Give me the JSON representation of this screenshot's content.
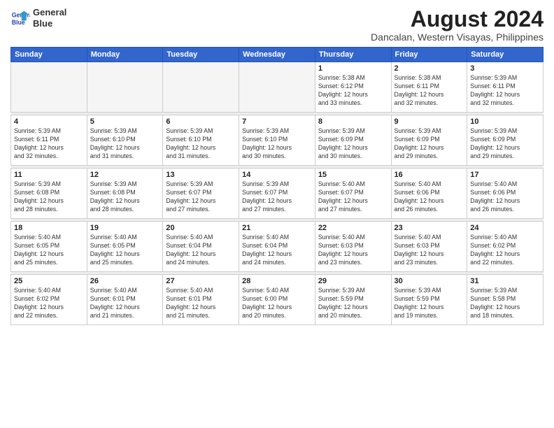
{
  "header": {
    "logo_line1": "General",
    "logo_line2": "Blue",
    "title": "August 2024",
    "subtitle": "Dancalan, Western Visayas, Philippines"
  },
  "days_of_week": [
    "Sunday",
    "Monday",
    "Tuesday",
    "Wednesday",
    "Thursday",
    "Friday",
    "Saturday"
  ],
  "weeks": [
    [
      {
        "day": "",
        "info": ""
      },
      {
        "day": "",
        "info": ""
      },
      {
        "day": "",
        "info": ""
      },
      {
        "day": "",
        "info": ""
      },
      {
        "day": "1",
        "info": "Sunrise: 5:38 AM\nSunset: 6:12 PM\nDaylight: 12 hours\nand 33 minutes."
      },
      {
        "day": "2",
        "info": "Sunrise: 5:38 AM\nSunset: 6:11 PM\nDaylight: 12 hours\nand 32 minutes."
      },
      {
        "day": "3",
        "info": "Sunrise: 5:39 AM\nSunset: 6:11 PM\nDaylight: 12 hours\nand 32 minutes."
      }
    ],
    [
      {
        "day": "4",
        "info": "Sunrise: 5:39 AM\nSunset: 6:11 PM\nDaylight: 12 hours\nand 32 minutes."
      },
      {
        "day": "5",
        "info": "Sunrise: 5:39 AM\nSunset: 6:10 PM\nDaylight: 12 hours\nand 31 minutes."
      },
      {
        "day": "6",
        "info": "Sunrise: 5:39 AM\nSunset: 6:10 PM\nDaylight: 12 hours\nand 31 minutes."
      },
      {
        "day": "7",
        "info": "Sunrise: 5:39 AM\nSunset: 6:10 PM\nDaylight: 12 hours\nand 30 minutes."
      },
      {
        "day": "8",
        "info": "Sunrise: 5:39 AM\nSunset: 6:09 PM\nDaylight: 12 hours\nand 30 minutes."
      },
      {
        "day": "9",
        "info": "Sunrise: 5:39 AM\nSunset: 6:09 PM\nDaylight: 12 hours\nand 29 minutes."
      },
      {
        "day": "10",
        "info": "Sunrise: 5:39 AM\nSunset: 6:09 PM\nDaylight: 12 hours\nand 29 minutes."
      }
    ],
    [
      {
        "day": "11",
        "info": "Sunrise: 5:39 AM\nSunset: 6:08 PM\nDaylight: 12 hours\nand 28 minutes."
      },
      {
        "day": "12",
        "info": "Sunrise: 5:39 AM\nSunset: 6:08 PM\nDaylight: 12 hours\nand 28 minutes."
      },
      {
        "day": "13",
        "info": "Sunrise: 5:39 AM\nSunset: 6:07 PM\nDaylight: 12 hours\nand 27 minutes."
      },
      {
        "day": "14",
        "info": "Sunrise: 5:39 AM\nSunset: 6:07 PM\nDaylight: 12 hours\nand 27 minutes."
      },
      {
        "day": "15",
        "info": "Sunrise: 5:40 AM\nSunset: 6:07 PM\nDaylight: 12 hours\nand 27 minutes."
      },
      {
        "day": "16",
        "info": "Sunrise: 5:40 AM\nSunset: 6:06 PM\nDaylight: 12 hours\nand 26 minutes."
      },
      {
        "day": "17",
        "info": "Sunrise: 5:40 AM\nSunset: 6:06 PM\nDaylight: 12 hours\nand 26 minutes."
      }
    ],
    [
      {
        "day": "18",
        "info": "Sunrise: 5:40 AM\nSunset: 6:05 PM\nDaylight: 12 hours\nand 25 minutes."
      },
      {
        "day": "19",
        "info": "Sunrise: 5:40 AM\nSunset: 6:05 PM\nDaylight: 12 hours\nand 25 minutes."
      },
      {
        "day": "20",
        "info": "Sunrise: 5:40 AM\nSunset: 6:04 PM\nDaylight: 12 hours\nand 24 minutes."
      },
      {
        "day": "21",
        "info": "Sunrise: 5:40 AM\nSunset: 6:04 PM\nDaylight: 12 hours\nand 24 minutes."
      },
      {
        "day": "22",
        "info": "Sunrise: 5:40 AM\nSunset: 6:03 PM\nDaylight: 12 hours\nand 23 minutes."
      },
      {
        "day": "23",
        "info": "Sunrise: 5:40 AM\nSunset: 6:03 PM\nDaylight: 12 hours\nand 23 minutes."
      },
      {
        "day": "24",
        "info": "Sunrise: 5:40 AM\nSunset: 6:02 PM\nDaylight: 12 hours\nand 22 minutes."
      }
    ],
    [
      {
        "day": "25",
        "info": "Sunrise: 5:40 AM\nSunset: 6:02 PM\nDaylight: 12 hours\nand 22 minutes."
      },
      {
        "day": "26",
        "info": "Sunrise: 5:40 AM\nSunset: 6:01 PM\nDaylight: 12 hours\nand 21 minutes."
      },
      {
        "day": "27",
        "info": "Sunrise: 5:40 AM\nSunset: 6:01 PM\nDaylight: 12 hours\nand 21 minutes."
      },
      {
        "day": "28",
        "info": "Sunrise: 5:40 AM\nSunset: 6:00 PM\nDaylight: 12 hours\nand 20 minutes."
      },
      {
        "day": "29",
        "info": "Sunrise: 5:39 AM\nSunset: 5:59 PM\nDaylight: 12 hours\nand 20 minutes."
      },
      {
        "day": "30",
        "info": "Sunrise: 5:39 AM\nSunset: 5:59 PM\nDaylight: 12 hours\nand 19 minutes."
      },
      {
        "day": "31",
        "info": "Sunrise: 5:39 AM\nSunset: 5:58 PM\nDaylight: 12 hours\nand 18 minutes."
      }
    ]
  ]
}
